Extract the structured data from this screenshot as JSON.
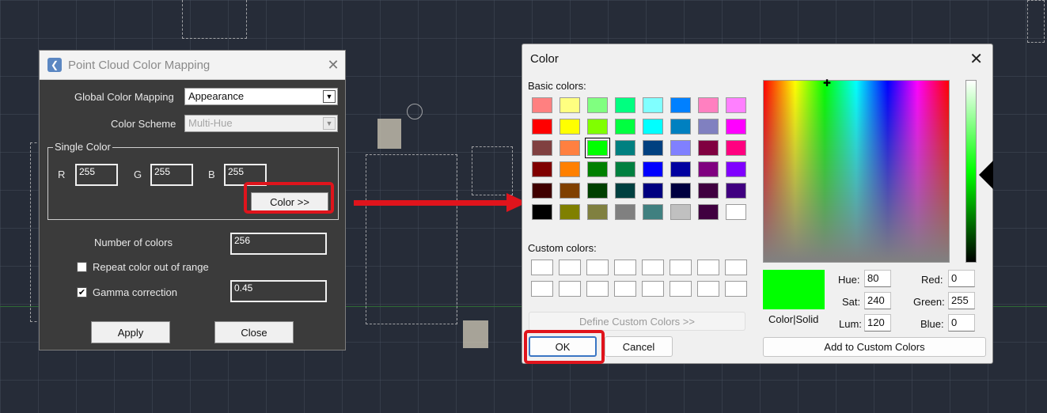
{
  "left_dialog": {
    "title": "Point Cloud Color Mapping",
    "global_color_mapping_label": "Global Color Mapping",
    "global_color_mapping_value": "Appearance",
    "color_scheme_label": "Color Scheme",
    "color_scheme_value": "Multi-Hue",
    "single_color_group": "Single Color",
    "r_label": "R",
    "r_value": "255",
    "g_label": "G",
    "g_value": "255",
    "b_label": "B",
    "b_value": "255",
    "color_button": "Color >>",
    "number_of_colors_label": "Number of colors",
    "number_of_colors_value": "256",
    "repeat_label": "Repeat color out of range",
    "repeat_checked": false,
    "gamma_label": "Gamma correction",
    "gamma_checked": true,
    "gamma_value": "0.45",
    "apply_button": "Apply",
    "close_button": "Close"
  },
  "color_dialog": {
    "title": "Color",
    "basic_colors_label": "Basic colors:",
    "basic_colors": [
      "#ff8080",
      "#ffff80",
      "#80ff80",
      "#00ff80",
      "#80ffff",
      "#0080ff",
      "#ff80c0",
      "#ff80ff",
      "#ff0000",
      "#ffff00",
      "#80ff00",
      "#00ff40",
      "#00ffff",
      "#0080c0",
      "#8080c0",
      "#ff00ff",
      "#804040",
      "#ff8040",
      "#00ff00",
      "#008080",
      "#004080",
      "#8080ff",
      "#800040",
      "#ff0080",
      "#800000",
      "#ff8000",
      "#008000",
      "#008040",
      "#0000ff",
      "#0000a0",
      "#800080",
      "#8000ff",
      "#400000",
      "#804000",
      "#004000",
      "#004040",
      "#000080",
      "#000040",
      "#400040",
      "#400080",
      "#000000",
      "#808000",
      "#808040",
      "#808080",
      "#408080",
      "#c0c0c0",
      "#400040",
      "#ffffff"
    ],
    "selected_basic_index": 18,
    "custom_colors_label": "Custom colors:",
    "define_custom_button": "Define Custom Colors >>",
    "ok_button": "OK",
    "cancel_button": "Cancel",
    "preview_label": "Color|Solid",
    "hue_label": "Hue:",
    "hue_value": "80",
    "sat_label": "Sat:",
    "sat_value": "240",
    "lum_label": "Lum:",
    "lum_value": "120",
    "red_label": "Red:",
    "red_value": "0",
    "green_label": "Green:",
    "green_value": "255",
    "blue_label": "Blue:",
    "blue_value": "0",
    "add_custom_button": "Add to Custom Colors",
    "current_color": "#00ff00"
  },
  "colors": {
    "highlight": "#e0141c",
    "background": "#262c38"
  }
}
